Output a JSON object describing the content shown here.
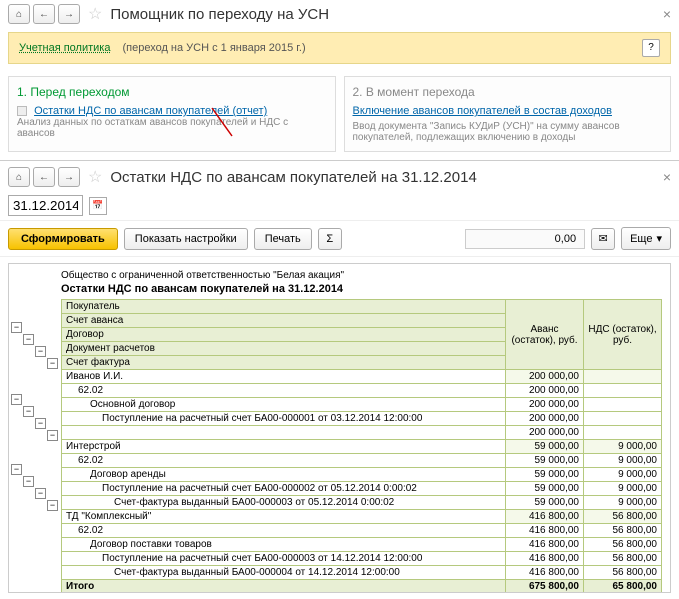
{
  "win1": {
    "title": "Помощник по переходу на УСН",
    "hint_link": "Учетная политика",
    "hint_text": "(переход на УСН с 1 января 2015 г.)"
  },
  "sec1": {
    "title": "1. Перед переходом",
    "link": "Остатки НДС по авансам покупателей (отчет)",
    "sub": "Анализ данных по остаткам авансов покупателей и НДС с авансов"
  },
  "sec2": {
    "title": "2. В момент перехода",
    "link": "Включение авансов покупателей в состав доходов",
    "sub": "Ввод документа \"Запись КУДиР (УСН)\" на сумму авансов покупателей, подлежащих включению в доходы"
  },
  "win2": {
    "title": "Остатки НДС по авансам покупателей на 31.12.2014",
    "date": "31.12.2014",
    "form_btn": "Сформировать",
    "settings_btn": "Показать настройки",
    "print_btn": "Печать",
    "sum": "0,00",
    "more_btn": "Еще"
  },
  "report": {
    "org": "Общество с ограниченной ответственностью \"Белая акация\"",
    "title": "Остатки НДС по авансам покупателей на 31.12.2014",
    "col1": "Покупатель",
    "col2": "Счет аванса",
    "col3": "Договор",
    "col4": "Документ расчетов",
    "col5": "Счет фактура",
    "h_avans": "Аванс (остаток), руб.",
    "h_nds": "НДС (остаток), руб.",
    "rows": [
      {
        "name": "Иванов И.И.",
        "a": "200 000,00",
        "n": ""
      },
      {
        "name": "62.02",
        "a": "200 000,00",
        "n": "",
        "indent": 1
      },
      {
        "name": "Основной договор",
        "a": "200 000,00",
        "n": "",
        "indent": 2
      },
      {
        "name": "Поступление на расчетный счет БА00-000001 от 03.12.2014 12:00:00",
        "a": "200 000,00",
        "n": "",
        "indent": 3
      },
      {
        "name": "",
        "a": "200 000,00",
        "n": "",
        "indent": 4
      },
      {
        "name": "Интерстрой",
        "a": "59 000,00",
        "n": "9 000,00"
      },
      {
        "name": "62.02",
        "a": "59 000,00",
        "n": "9 000,00",
        "indent": 1
      },
      {
        "name": "Договор аренды",
        "a": "59 000,00",
        "n": "9 000,00",
        "indent": 2
      },
      {
        "name": "Поступление на расчетный счет БА00-000002 от 05.12.2014 0:00:02",
        "a": "59 000,00",
        "n": "9 000,00",
        "indent": 3
      },
      {
        "name": "Счет-фактура выданный БА00-000003 от 05.12.2014 0:00:02",
        "a": "59 000,00",
        "n": "9 000,00",
        "indent": 4
      },
      {
        "name": "ТД \"Комплексный\"",
        "a": "416 800,00",
        "n": "56 800,00"
      },
      {
        "name": "62.02",
        "a": "416 800,00",
        "n": "56 800,00",
        "indent": 1
      },
      {
        "name": "Договор поставки товаров",
        "a": "416 800,00",
        "n": "56 800,00",
        "indent": 2
      },
      {
        "name": "Поступление на расчетный счет БА00-000003 от 14.12.2014 12:00:00",
        "a": "416 800,00",
        "n": "56 800,00",
        "indent": 3
      },
      {
        "name": "Счет-фактура выданный БА00-000004 от 14.12.2014 12:00:00",
        "a": "416 800,00",
        "n": "56 800,00",
        "indent": 4
      }
    ],
    "total_lbl": "Итого",
    "total_a": "675 800,00",
    "total_n": "65 800,00"
  }
}
